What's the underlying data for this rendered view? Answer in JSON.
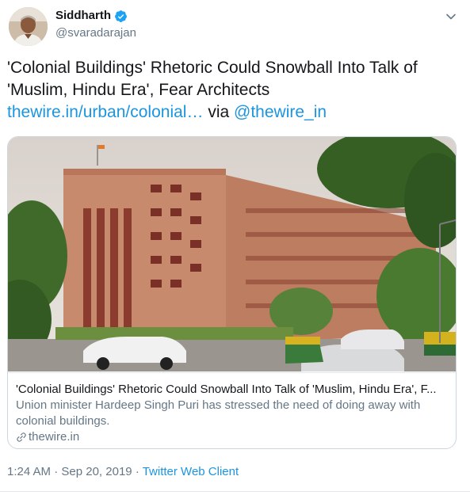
{
  "author": {
    "name": "Siddharth",
    "handle": "@svaradarajan",
    "verified": true
  },
  "tweet": {
    "text": "'Colonial Buildings' Rhetoric Could Snowball Into Talk of 'Muslim, Hindu Era', Fear Architects",
    "link_text": "thewire.in/urban/colonial…",
    "via_text": "via",
    "mention": "@thewire_in"
  },
  "card": {
    "title": "'Colonial Buildings' Rhetoric Could Snowball Into Talk of 'Muslim, Hindu Era', F...",
    "description": "Union minister Hardeep Singh Puri has stressed the need of doing away with colonial buildings.",
    "domain": "thewire.in",
    "image_alt_icon": "photo-building"
  },
  "meta": {
    "time": "1:24 AM",
    "separator": "·",
    "date": "Sep 20, 2019",
    "client": "Twitter Web Client"
  },
  "colors": {
    "link": "#1b95e0",
    "secondary_text": "#657786",
    "primary_text": "#14171a",
    "border": "#ccd6dd"
  },
  "icons": [
    "verified-badge-icon",
    "chevron-down-icon",
    "link-icon"
  ]
}
